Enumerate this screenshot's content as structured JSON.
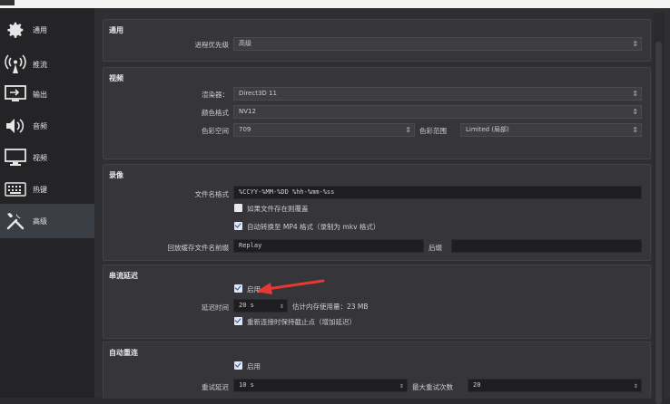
{
  "sidebar": {
    "items": [
      {
        "label": "通用",
        "icon": "gear-icon"
      },
      {
        "label": "推流",
        "icon": "broadcast-icon"
      },
      {
        "label": "输出",
        "icon": "output-icon"
      },
      {
        "label": "音频",
        "icon": "speaker-icon"
      },
      {
        "label": "视频",
        "icon": "monitor-icon"
      },
      {
        "label": "热键",
        "icon": "keyboard-icon"
      },
      {
        "label": "高级",
        "icon": "tools-icon"
      }
    ],
    "active": "高级"
  },
  "general": {
    "title": "通用",
    "priority_label": "进程优先级",
    "priority_value": "高级"
  },
  "video": {
    "title": "视频",
    "renderer_label": "渲染器：",
    "renderer_value": "Direct3D 11",
    "color_format_label": "颜色格式",
    "color_format_value": "NV12",
    "color_space_label": "色彩空间",
    "color_space_value": "709",
    "color_range_label": "色彩范围",
    "color_range_value": "Limited (局部)"
  },
  "recording": {
    "title": "录像",
    "filename_label": "文件名格式",
    "filename_value": "%CCYY-%MM-%DD %hh-%mm-%ss",
    "overwrite_label": "如果文件存在则覆盖",
    "overwrite_checked": false,
    "remux_label": "自动转换至 MP4 格式（录制为 mkv 格式）",
    "remux_checked": true,
    "replay_label": "回放缓存文件名前缀",
    "replay_value": "Replay",
    "suffix_label": "后缀",
    "suffix_value": ""
  },
  "stream_delay": {
    "title": "串流延迟",
    "enable_label": "启用",
    "enable_checked": true,
    "duration_label": "延迟时间",
    "duration_value": "20 s",
    "memory_label": "估计内存使用量：23 MB",
    "preserve_label": "重新连接时保持截止点（增加延迟）",
    "preserve_checked": true
  },
  "reconnect": {
    "title": "自动重连",
    "enable_label": "启用",
    "enable_checked": true,
    "delay_label": "重试延迟",
    "delay_value": "10 s",
    "max_label": "最大重试次数",
    "max_value": "20"
  },
  "colors": {
    "annotation_arrow": "#e53935"
  }
}
